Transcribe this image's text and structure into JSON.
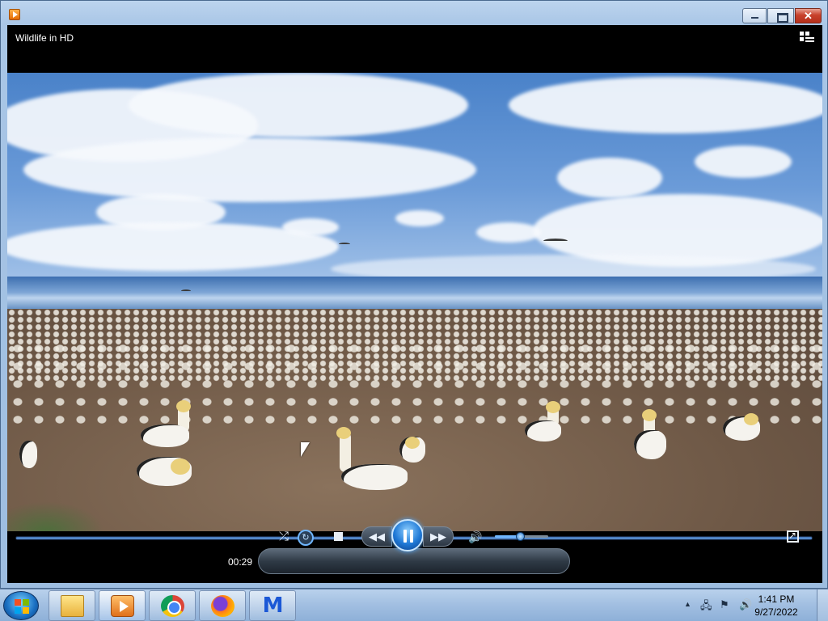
{
  "window": {
    "title": "Wildlife in HD"
  },
  "player": {
    "time_elapsed": "00:29",
    "seek_progress": 0.99,
    "volume_level": 0.48,
    "state": "playing"
  },
  "taskbar": {
    "pinned": [
      "Windows Explorer",
      "Windows Media Player",
      "Google Chrome",
      "Mozilla Firefox",
      "Malwarebytes"
    ],
    "clock_time": "1:41 PM",
    "clock_date": "9/27/2022"
  },
  "colors": {
    "accent": "#1f79d6",
    "player_bg": "#000000",
    "taskbar": "#a3c0e2"
  }
}
